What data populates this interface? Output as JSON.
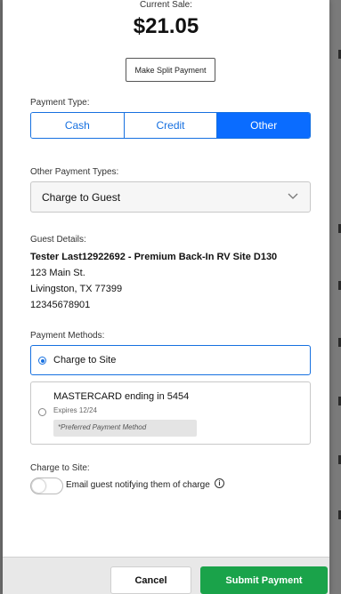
{
  "sale": {
    "label": "Current Sale:",
    "amount": "$21.05",
    "split_label": "Make Split Payment"
  },
  "payment_type": {
    "label": "Payment Type:",
    "options": [
      "Cash",
      "Credit",
      "Other"
    ],
    "selected": "Other"
  },
  "other_types": {
    "label": "Other Payment Types:",
    "selected": "Charge to Guest"
  },
  "guest": {
    "label": "Guest Details:",
    "name": "Tester Last12922692 - Premium Back-In RV Site D130",
    "address1": "123 Main St.",
    "address2": "Livingston, TX 77399",
    "phone": "12345678901"
  },
  "payment_methods": {
    "label": "Payment Methods:",
    "site": "Charge to Site",
    "card_title": "MASTERCARD ending in 5454",
    "card_expires": "Expires 12/24",
    "card_note": "*Preferred Payment Method"
  },
  "charge_to_site": {
    "label": "Charge to Site:",
    "email_toggle_label": "Email guest notifying them of charge"
  },
  "footer": {
    "cancel": "Cancel",
    "submit": "Submit Payment"
  },
  "colors": {
    "accent": "#0a6cff",
    "submit": "#1aa34a"
  }
}
